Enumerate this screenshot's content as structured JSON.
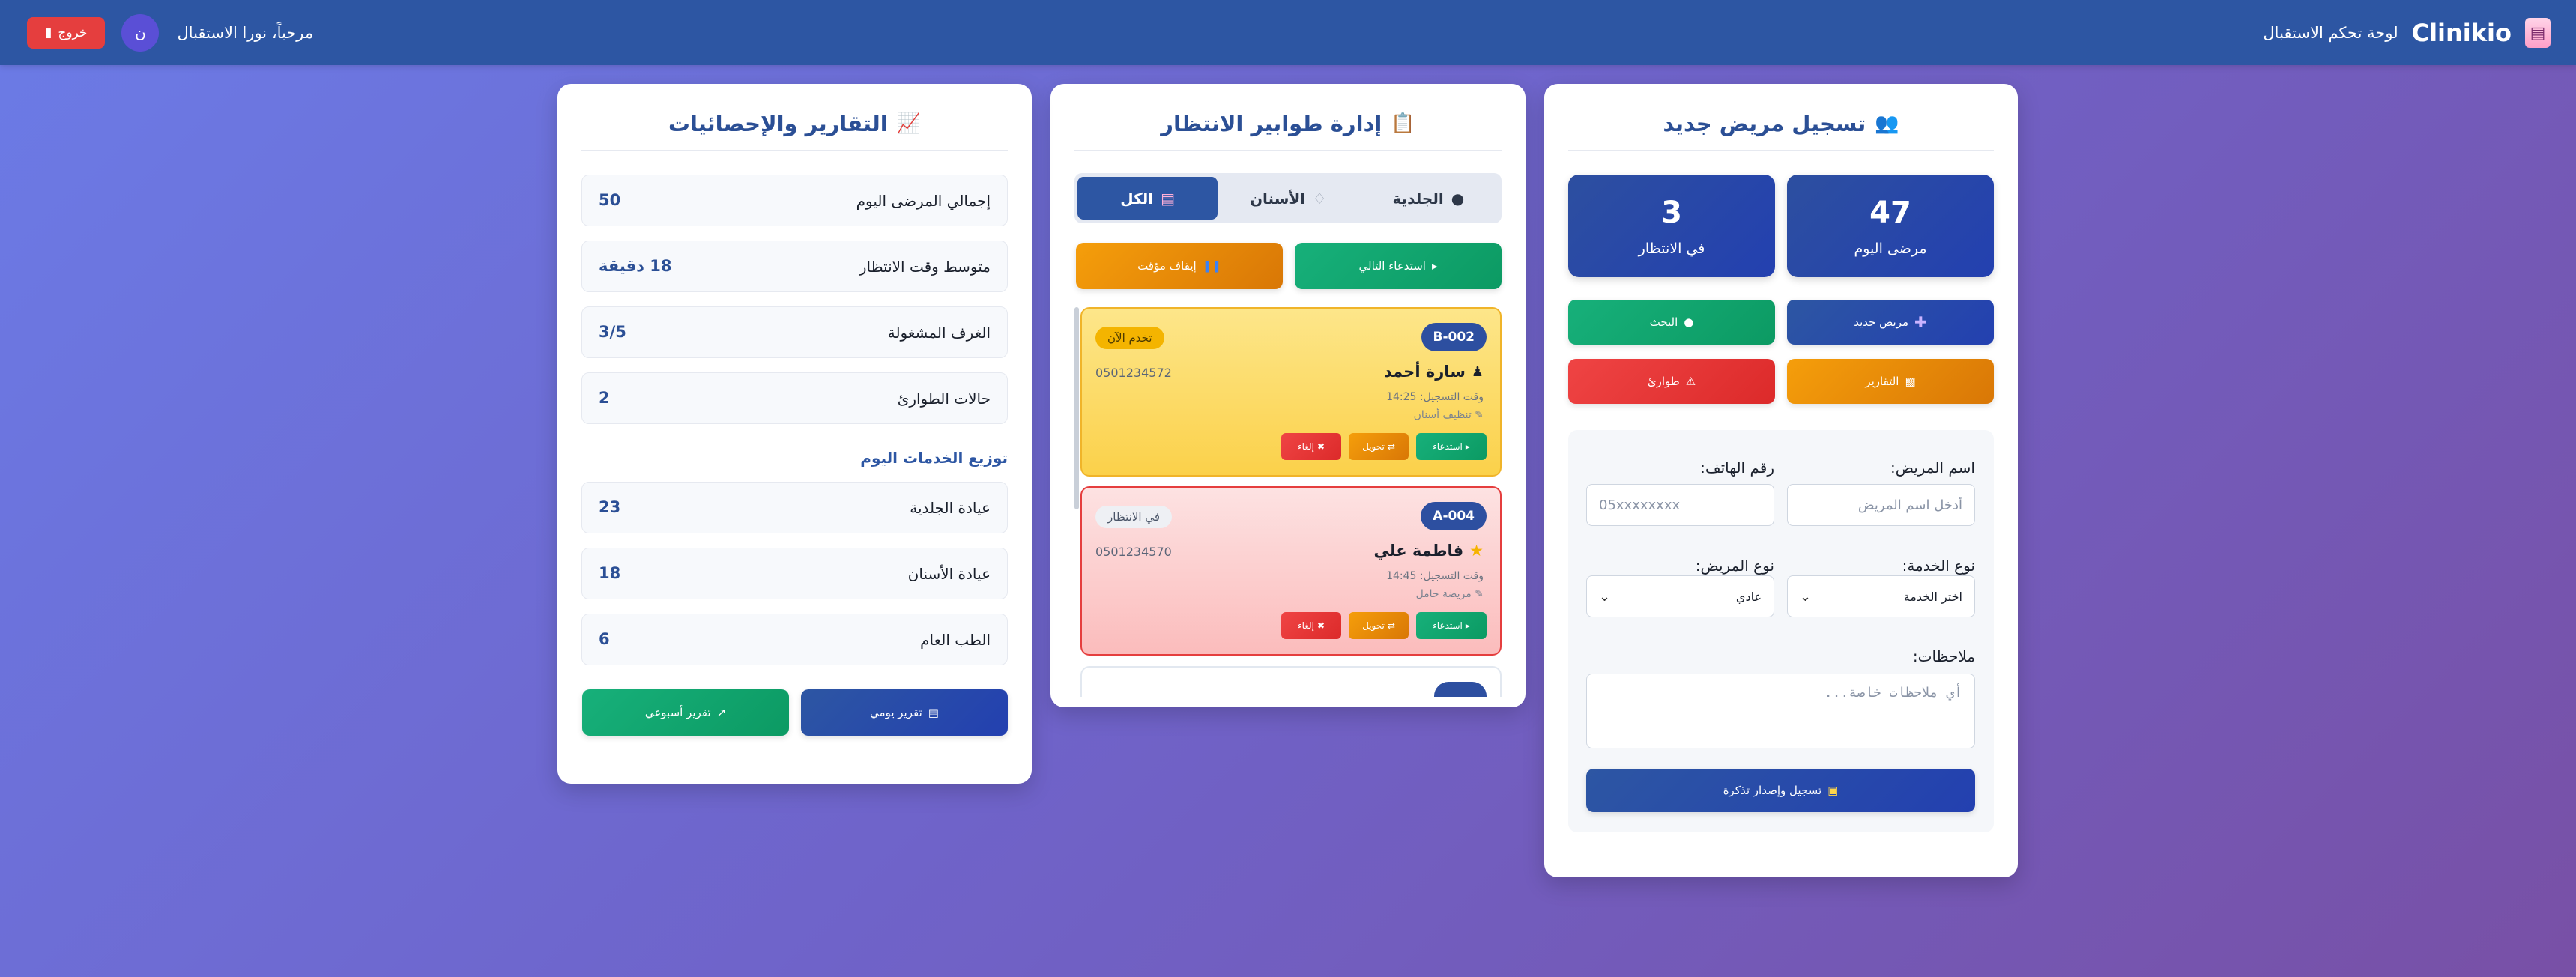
{
  "header": {
    "brand_name": "Clinikio",
    "brand_subtitle": "لوحة تحكم الاستقبال",
    "welcome": "مرحباً، نورا الاستقبال",
    "avatar_letter": "ن",
    "logout_label": "خروج",
    "logout_icon": "door-icon"
  },
  "register": {
    "title": "تسجيل مريض جديد",
    "title_icon": "users-icon",
    "stats": {
      "today_value": "47",
      "today_label": "مرضى اليوم",
      "waiting_value": "3",
      "waiting_label": "في الانتظار"
    },
    "buttons": {
      "new_patient": "مريض جديد",
      "search": "البحث",
      "reports": "التقارير",
      "emergency": "طوارئ"
    },
    "form": {
      "name_label": "اسم المريض:",
      "name_placeholder": "أدخل اسم المريض",
      "phone_label": "رقم الهاتف:",
      "phone_placeholder": "05xxxxxxxx",
      "service_label": "نوع الخدمة:",
      "service_value": "اختر الخدمة",
      "ptype_label": "نوع المريض:",
      "ptype_value": "عادي",
      "notes_label": "ملاحظات:",
      "notes_placeholder": "أي ملاحظات خاصة...",
      "submit_label": "تسجيل وإصدار تذكرة"
    }
  },
  "queue": {
    "title": "إدارة طوابير الانتظار",
    "title_icon": "clipboard-icon",
    "tabs": [
      {
        "label": "الجلدية",
        "icon": "derm-icon"
      },
      {
        "label": "الأسنان",
        "icon": "tooth-icon"
      },
      {
        "label": "الكل",
        "icon": "hospital-icon"
      }
    ],
    "call_next_label": "استدعاء التالي",
    "pause_label": "إيقاف مؤقت",
    "tickets": [
      {
        "number": "B-002",
        "status": "تخدم الآن",
        "name": "سارة أحمد",
        "name_icon": "person-icon",
        "phone": "0501234572",
        "time": "وقت التسجيل: 14:25",
        "note": "تنظيف أسنان"
      },
      {
        "number": "A-004",
        "status": "في الانتظار",
        "name": "فاطمة علي",
        "name_icon": "star-icon",
        "phone": "0501234570",
        "time": "وقت التسجيل: 14:45",
        "note": "مريضة حامل"
      }
    ],
    "ticket_actions": {
      "call": "استدعاء",
      "transfer": "تحويل",
      "cancel": "إلغاء"
    }
  },
  "reports": {
    "title": "التقارير والإحصائيات",
    "title_icon": "chart-up-icon",
    "rows": [
      {
        "label": "إجمالي المرضى اليوم",
        "value": "50"
      },
      {
        "label": "متوسط وقت الانتظار",
        "value": "18 دقيقة"
      },
      {
        "label": "الغرف المشغولة",
        "value": "3/5"
      },
      {
        "label": "حالات الطوارئ",
        "value": "2"
      }
    ],
    "distribution_heading": "توزيع الخدمات اليوم",
    "distribution": [
      {
        "label": "عيادة الجلدية",
        "value": "23"
      },
      {
        "label": "عيادة الأسنان",
        "value": "18"
      },
      {
        "label": "الطب العام",
        "value": "6"
      }
    ],
    "daily_label": "تقرير يومي",
    "weekly_label": "تقرير أسبوعي"
  }
}
